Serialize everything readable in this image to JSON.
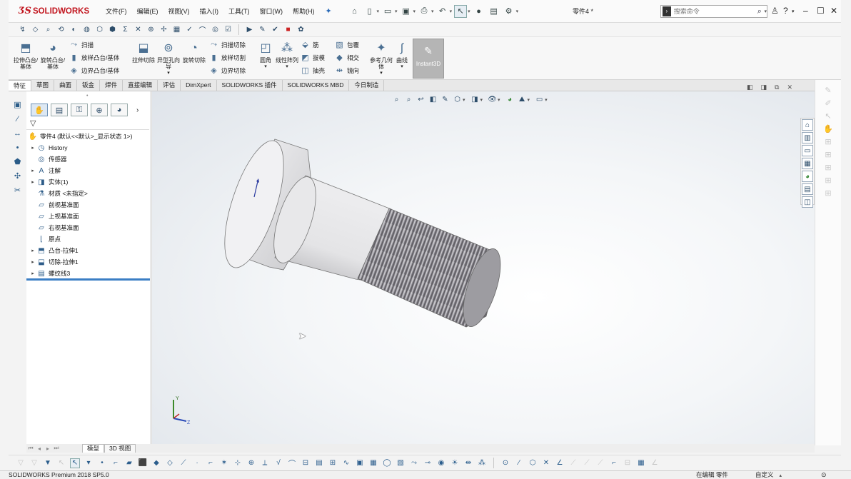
{
  "app": {
    "brand_ds": "ƷS",
    "brand_name": "SOLIDWORKS",
    "doc_title": "零件4 *"
  },
  "menu": [
    "文件(F)",
    "编辑(E)",
    "视图(V)",
    "插入(I)",
    "工具(T)",
    "窗口(W)",
    "帮助(H)"
  ],
  "search": {
    "placeholder": "搜索命令"
  },
  "commands": {
    "extrude_boss": "拉伸凸台/基体",
    "revolve_boss": "旋转凸台/基体",
    "sweep": "扫描",
    "loft_boss": "放样凸台/基体",
    "boundary_boss": "边界凸台/基体",
    "extrude_cut": "拉伸切除",
    "hole_wizard": "异型孔向导",
    "revolve_cut": "旋转切除",
    "sweep_cut": "扫描切除",
    "loft_cut": "放样切割",
    "boundary_cut": "边界切除",
    "fillet": "圆角",
    "linear_pattern": "线性阵列",
    "rib": "筋",
    "draft": "拔模",
    "shell": "抽壳",
    "wrap": "包覆",
    "intersect": "相交",
    "mirror": "镜向",
    "reference_geometry": "参考几何体",
    "curves": "曲线",
    "instant3d": "Instant3D"
  },
  "tabs": [
    "特征",
    "草图",
    "曲面",
    "钣金",
    "焊件",
    "直接编辑",
    "评估",
    "DimXpert",
    "SOLIDWORKS 插件",
    "SOLIDWORKS MBD",
    "今日制造"
  ],
  "feature_tree": {
    "root": "零件4  (默认<<默认>_显示状态 1>)",
    "nodes": [
      {
        "label": "History",
        "icon": "history-icon",
        "expandable": true
      },
      {
        "label": "传感器",
        "icon": "sensor-icon",
        "expandable": false
      },
      {
        "label": "注解",
        "icon": "annotation-icon",
        "expandable": true
      },
      {
        "label": "实体(1)",
        "icon": "solid-body-icon",
        "expandable": true
      },
      {
        "label": "材质 <未指定>",
        "icon": "material-icon",
        "expandable": false
      },
      {
        "label": "前视基准面",
        "icon": "plane-icon",
        "expandable": false
      },
      {
        "label": "上视基准面",
        "icon": "plane-icon",
        "expandable": false
      },
      {
        "label": "右视基准面",
        "icon": "plane-icon",
        "expandable": false
      },
      {
        "label": "原点",
        "icon": "origin-icon",
        "expandable": false
      },
      {
        "label": "凸台-拉伸1",
        "icon": "boss-extrude-icon",
        "expandable": true
      },
      {
        "label": "切除-拉伸1",
        "icon": "cut-extrude-icon",
        "expandable": true
      },
      {
        "label": "螺纹线3",
        "icon": "thread-icon",
        "expandable": true
      }
    ]
  },
  "model_tabs": [
    "模型",
    "3D 视图"
  ],
  "triad": {
    "y": "Y",
    "z": "Z"
  },
  "status": {
    "version": "SOLIDWORKS Premium 2018 SP5.0",
    "editing": "在编辑 零件",
    "units": "自定义",
    "help": "?"
  }
}
